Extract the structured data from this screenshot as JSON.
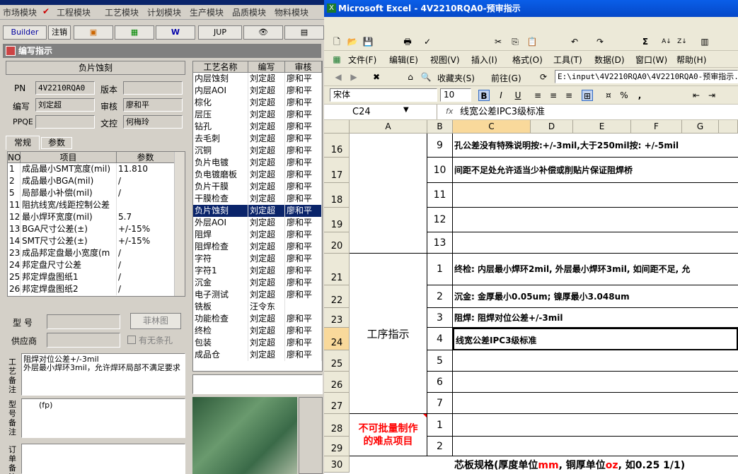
{
  "left_app": {
    "menu": [
      "市场模块",
      "工程模块",
      "工艺模块",
      "计划模块",
      "生产模块",
      "品质模块",
      "物料模块"
    ],
    "toolbar": {
      "builder": "Builder",
      "logout": "注销",
      "jup": "JUP"
    },
    "window_title": "编写指示",
    "process_name": "负片蚀刻",
    "pn_label": "PN",
    "pn_value": "4V2210RQA0",
    "version_label": "版本",
    "version_value": "",
    "author_label": "编写",
    "author_value": "刘定超",
    "reviewer_label": "审核",
    "reviewer_value": "廖和平",
    "ppqe_label": "PPQE",
    "ppqe_value": "",
    "docctl_label": "文控",
    "docctl_value": "何梅玲",
    "tabs": [
      "常规",
      "参数"
    ],
    "param_headers": [
      "NO",
      "项目",
      "参数"
    ],
    "params": [
      [
        "1",
        "成品最小SMT宽度(mil)",
        "11.810"
      ],
      [
        "2",
        "成品最小BGA(mil)",
        "/"
      ],
      [
        "5",
        "局部最小补偿(mil)",
        "/"
      ],
      [
        "11",
        "阻抗线宽/线距控制公差",
        ""
      ],
      [
        "12",
        "最小焊环宽度(mil)",
        "5.7"
      ],
      [
        "13",
        "BGA尺寸公差(±)",
        "+/-15%"
      ],
      [
        "14",
        "SMT尺寸公差(±)",
        "+/-15%"
      ],
      [
        "23",
        "成品邦定盘最小宽度(m",
        "/"
      ],
      [
        "24",
        "邦定盘尺寸公差",
        "/"
      ],
      [
        "25",
        "邦定焊盘图纸1",
        "/"
      ],
      [
        "26",
        "邦定焊盘图纸2",
        "/"
      ]
    ],
    "model_label": "型  号",
    "feilin_button": "菲林图",
    "supplier_label": "供应商",
    "no_hole_label": "有无条孔",
    "process_note_label": "工艺备注",
    "process_note": "阻焊对位公差+/-3mil\n外层最小焊环3mil，允许焊环局部不满足要求",
    "model_note_label": "型号备注",
    "model_note": "(fp)",
    "order_note_label": "订单备注",
    "proc_headers": [
      "工艺名称",
      "编写",
      "审核"
    ],
    "processes": [
      [
        "内层蚀刻",
        "刘定超",
        "廖和平"
      ],
      [
        "内层AOI",
        "刘定超",
        "廖和平"
      ],
      [
        "棕化",
        "刘定超",
        "廖和平"
      ],
      [
        "层压",
        "刘定超",
        "廖和平"
      ],
      [
        "钻孔",
        "刘定超",
        "廖和平"
      ],
      [
        "去毛刺",
        "刘定超",
        "廖和平"
      ],
      [
        "沉铜",
        "刘定超",
        "廖和平"
      ],
      [
        "负片电镀",
        "刘定超",
        "廖和平"
      ],
      [
        "负电镀磨板",
        "刘定超",
        "廖和平"
      ],
      [
        "负片干膜",
        "刘定超",
        "廖和平"
      ],
      [
        "干膜检查",
        "刘定超",
        "廖和平"
      ],
      [
        "负片蚀刻",
        "刘定超",
        "廖和平"
      ],
      [
        "外层AOI",
        "刘定超",
        "廖和平"
      ],
      [
        "阻焊",
        "刘定超",
        "廖和平"
      ],
      [
        "阻焊检查",
        "刘定超",
        "廖和平"
      ],
      [
        "字符",
        "刘定超",
        "廖和平"
      ],
      [
        "字符1",
        "刘定超",
        "廖和平"
      ],
      [
        "沉金",
        "刘定超",
        "廖和平"
      ],
      [
        "电子测试",
        "刘定超",
        "廖和平"
      ],
      [
        "铣板",
        "汪令东",
        ""
      ],
      [
        "功能检查",
        "刘定超",
        "廖和平"
      ],
      [
        "终检",
        "刘定超",
        "廖和平"
      ],
      [
        "包装",
        "刘定超",
        "廖和平"
      ],
      [
        "成品仓",
        "刘定超",
        "廖和平"
      ]
    ],
    "selected_process_index": 11
  },
  "excel": {
    "title": "Microsoft Excel - 4V2210RQA0-预审指示",
    "menus": [
      "文件(F)",
      "编辑(E)",
      "视图(V)",
      "插入(I)",
      "格式(O)",
      "工具(T)",
      "数据(D)",
      "窗口(W)",
      "帮助(H)"
    ],
    "favorites": "收藏夹(S)",
    "goto": "前往(G)",
    "path": "E:\\input\\4V2210RQA0\\4V2210RQA0-预审指示.xl",
    "font": "宋体",
    "font_size": "10",
    "namebox": "C24",
    "fx": "fx",
    "formula": "线宽公差IPC3级标准",
    "columns": [
      "A",
      "B",
      "C",
      "D",
      "E",
      "F",
      "G"
    ],
    "rows": [
      {
        "n": "16",
        "b": "9",
        "c": "孔公差没有特殊说明按:+/-3mil,大于250mil按: +/-5mil"
      },
      {
        "n": "17",
        "b": "10",
        "c": "间距不足处允许适当少补偿或削贴片保证阻焊桥"
      },
      {
        "n": "18",
        "b": "11",
        "c": ""
      },
      {
        "n": "19",
        "b": "12",
        "c": ""
      },
      {
        "n": "20",
        "b": "13",
        "c": ""
      },
      {
        "n": "21",
        "b": "1",
        "c": "终检: 内层最小焊环2mil, 外层最小焊环3mil, 如间距不足, 允"
      },
      {
        "n": "22",
        "b": "2",
        "c": "沉金: 金厚最小0.05um; 镍厚最小3.048um"
      },
      {
        "n": "23",
        "b": "3",
        "c": "阻焊: 阻焊对位公差+/-3mil"
      },
      {
        "n": "24",
        "b": "4",
        "c": "线宽公差IPC3级标准"
      },
      {
        "n": "25",
        "b": "5",
        "c": ""
      },
      {
        "n": "26",
        "b": "6",
        "c": ""
      },
      {
        "n": "27",
        "b": "7",
        "c": ""
      },
      {
        "n": "28",
        "b": "1",
        "c": ""
      },
      {
        "n": "29",
        "b": "2",
        "c": ""
      },
      {
        "n": "30",
        "b": "",
        "c": ""
      }
    ],
    "section_process": "工序指示",
    "section_difficulty": "不可批量制作的难点项目",
    "row30_text_a": "芯板规格(厚度单位",
    "row30_mm": "mm",
    "row30_text_b": ", 铜厚单位",
    "row30_oz": "oz",
    "row30_text_c": ", 如0.25 1/1)",
    "colors": {
      "red": "#ff0000",
      "selection": "#0a246a",
      "title": "#0548c8"
    }
  }
}
